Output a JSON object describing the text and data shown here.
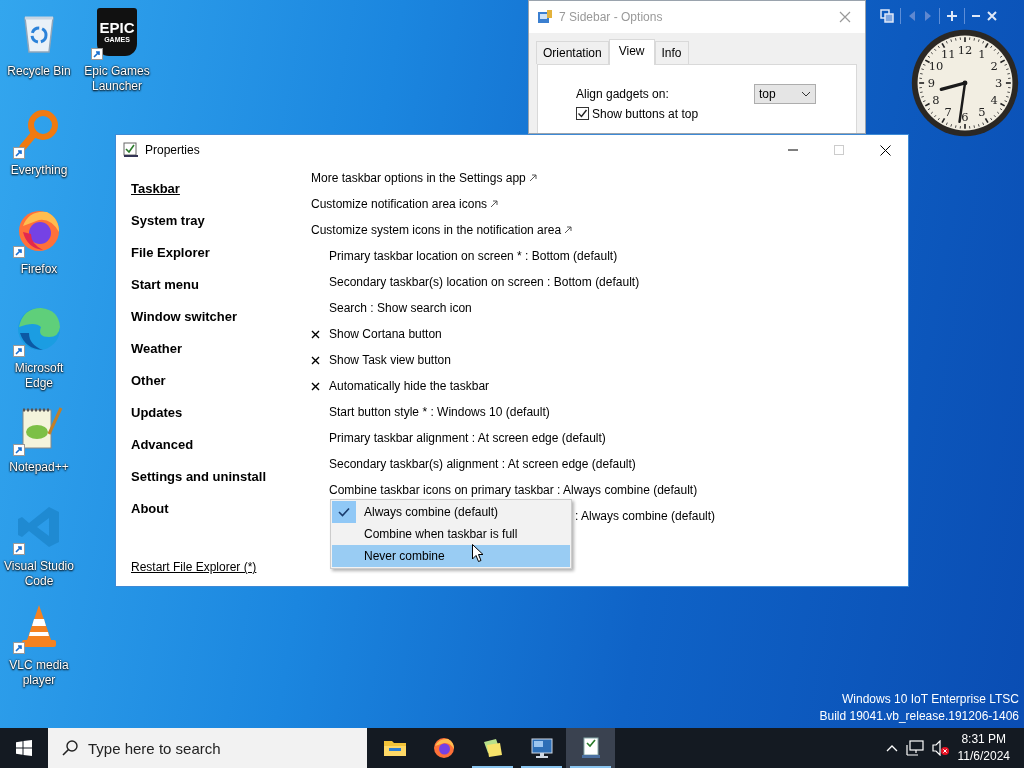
{
  "desktop_icons": [
    {
      "label": "Recycle Bin",
      "kind": "recycle",
      "shortcut": false
    },
    {
      "label": "Everything",
      "kind": "everything",
      "shortcut": true
    },
    {
      "label": "Firefox",
      "kind": "firefox",
      "shortcut": true
    },
    {
      "label": "Microsoft Edge",
      "kind": "edge",
      "shortcut": true
    },
    {
      "label": "Notepad++",
      "kind": "notepad",
      "shortcut": true
    },
    {
      "label": "Visual Studio Code",
      "kind": "vscode",
      "shortcut": true
    },
    {
      "label": "VLC media player",
      "kind": "vlc",
      "shortcut": true
    },
    {
      "label": "Epic Games Launcher",
      "kind": "epic",
      "shortcut": true,
      "logo_text": [
        "EPIC",
        "GAMES"
      ]
    }
  ],
  "sidebar_options": {
    "title": "7 Sidebar - Options",
    "tabs": [
      {
        "label": "Orientation",
        "selected": false
      },
      {
        "label": "View",
        "selected": true
      },
      {
        "label": "Info",
        "selected": false
      }
    ],
    "align_label": "Align gadgets on:",
    "align_value": "top",
    "checkboxes": [
      {
        "label": "Show buttons at top",
        "checked": true
      }
    ]
  },
  "clock": {
    "numerals": [
      "12",
      "11",
      "1",
      "10",
      "2",
      "9",
      "3",
      "8",
      "4",
      "7",
      "5",
      "6"
    ]
  },
  "properties": {
    "title": "Properties",
    "maximize_enabled": false,
    "nav": [
      {
        "label": "Taskbar",
        "selected": true
      },
      {
        "label": "System tray",
        "selected": false
      },
      {
        "label": "File Explorer",
        "selected": false
      },
      {
        "label": "Start menu",
        "selected": false
      },
      {
        "label": "Window switcher",
        "selected": false
      },
      {
        "label": "Weather",
        "selected": false
      },
      {
        "label": "Other",
        "selected": false
      },
      {
        "label": "Updates",
        "selected": false
      },
      {
        "label": "Advanced",
        "selected": false
      },
      {
        "label": "Settings and uninstall",
        "selected": false
      },
      {
        "label": "About",
        "selected": false
      }
    ],
    "restart_link": "Restart File Explorer (*)",
    "options": [
      {
        "kind": "link",
        "text": "More taskbar options in the Settings app"
      },
      {
        "kind": "link",
        "text": "Customize notification area icons"
      },
      {
        "kind": "link",
        "text": "Customize system icons in the notification area"
      },
      {
        "kind": "setting",
        "text": "Primary taskbar location on screen * : Bottom (default)"
      },
      {
        "kind": "setting",
        "text": "Secondary taskbar(s) location on screen : Bottom (default)"
      },
      {
        "kind": "setting",
        "text": "Search : Show search icon"
      },
      {
        "kind": "toggle",
        "text": "Show Cortana button",
        "checked": false
      },
      {
        "kind": "toggle",
        "text": "Show Task view button",
        "checked": false
      },
      {
        "kind": "toggle",
        "text": "Automatically hide the taskbar",
        "checked": false
      },
      {
        "kind": "setting",
        "text": "Start button style * : Windows 10 (default)"
      },
      {
        "kind": "setting",
        "text": "Primary taskbar alignment : At screen edge (default)"
      },
      {
        "kind": "setting",
        "text": "Secondary taskbar(s) alignment : At screen edge (default)"
      },
      {
        "kind": "setting",
        "text": "Combine taskbar icons on primary taskbar : Always combine (default)"
      },
      {
        "kind": "covered",
        "text": ": Always combine (default)"
      }
    ]
  },
  "menu": {
    "items": [
      {
        "label": "Always combine (default)",
        "checked": true,
        "selected": false
      },
      {
        "label": "Combine when taskbar is full",
        "checked": false,
        "selected": false
      },
      {
        "label": "Never combine",
        "checked": false,
        "selected": true
      }
    ]
  },
  "system_info": {
    "lines": [
      "Windows 10 IoT Enterprise LTSC",
      "Build 19041.vb_release.191206-1406"
    ]
  },
  "taskbar": {
    "search_placeholder": "Type here to search",
    "apps": [
      {
        "kind": "folder",
        "running": false,
        "selected": false
      },
      {
        "kind": "firefox",
        "running": false,
        "selected": false
      },
      {
        "kind": "notes",
        "running": true,
        "selected": false
      },
      {
        "kind": "monitor",
        "running": true,
        "selected": false
      },
      {
        "kind": "properties",
        "running": true,
        "selected": true
      }
    ],
    "time": "8:31 PM",
    "date": "11/6/2024"
  }
}
